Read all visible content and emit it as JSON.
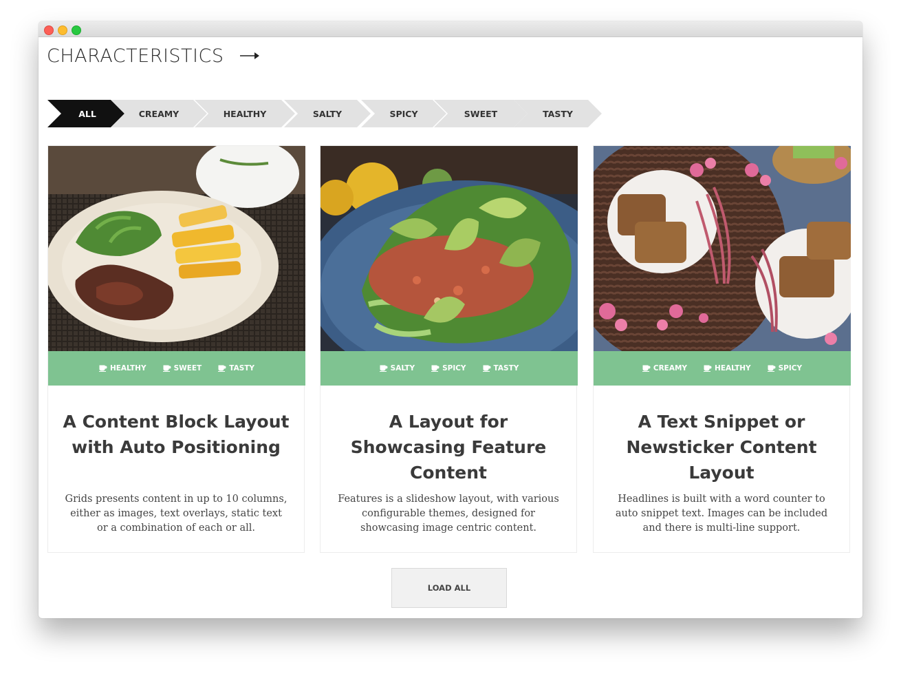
{
  "header": {
    "title": "CHARACTERISTICS",
    "arrow_icon": "arrow-right-icon"
  },
  "filters": [
    {
      "label": "ALL",
      "active": true
    },
    {
      "label": "CREAMY",
      "active": false
    },
    {
      "label": "HEALTHY",
      "active": false
    },
    {
      "label": "SALTY",
      "active": false
    },
    {
      "label": "SPICY",
      "active": false
    },
    {
      "label": "SWEET",
      "active": false
    },
    {
      "label": "TASTY",
      "active": false
    }
  ],
  "cards": [
    {
      "image_alt": "Plate with sliced steak, green salad and grilled pineapple",
      "tags": [
        "HEALTHY",
        "SWEET",
        "TASTY"
      ],
      "title": "A Content Block Layout with Auto Positioning",
      "description": "Grids presents content in up to 10 columns, either as images, text overlays, static text or a combination of each or all."
    },
    {
      "image_alt": "Blue plate with lettuce, avocado slices and bulgur salad",
      "tags": [
        "SALTY",
        "SPICY",
        "TASTY"
      ],
      "title": "A Layout for Showcasing Feature Content",
      "description": "Features is a slideshow layout, with various configurable themes, designed for showcasing image centric content."
    },
    {
      "image_alt": "Rhubarb cake squares on white plates with pink flowers",
      "tags": [
        "CREAMY",
        "HEALTHY",
        "SPICY"
      ],
      "title": "A Text Snippet or Newsticker Content Layout",
      "description": "Headlines is built with a word counter to auto snippet text. Images can be included and there is multi-line support."
    }
  ],
  "load_button": "LOAD ALL",
  "colors": {
    "accent_green": "#7fc391",
    "active_filter": "#111111",
    "filter_bg": "#e2e2e2"
  }
}
